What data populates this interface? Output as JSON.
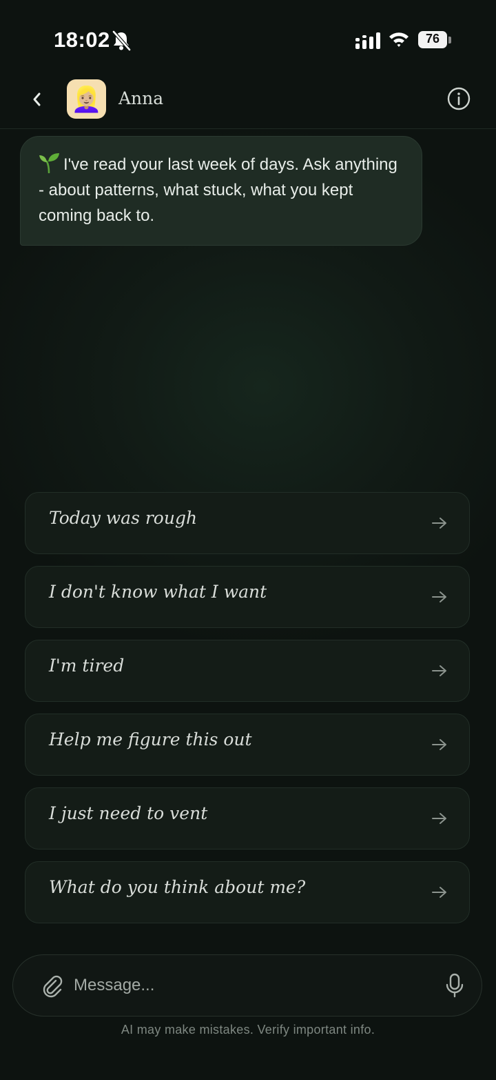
{
  "status_bar": {
    "time": "18:02",
    "battery": "76"
  },
  "header": {
    "contact_name": "Anna",
    "avatar_emoji": "👱🏼‍♀️"
  },
  "chat": {
    "intro_message": "I've read your last week of days. Ask anything - about patterns, what stuck, what you kept coming back to."
  },
  "suggestions": [
    {
      "label": "Today was rough"
    },
    {
      "label": "I don't know what I want"
    },
    {
      "label": "I'm tired"
    },
    {
      "label": "Help me figure this out"
    },
    {
      "label": "I just need to vent"
    },
    {
      "label": "What do you think about me?"
    }
  ],
  "composer": {
    "placeholder": "Message..."
  },
  "footer": {
    "disclaimer": "AI may make mistakes. Verify important info."
  },
  "colors": {
    "background": "#111a15",
    "bubble": "#1f2c24",
    "accent_green": "#7bbf4a"
  }
}
